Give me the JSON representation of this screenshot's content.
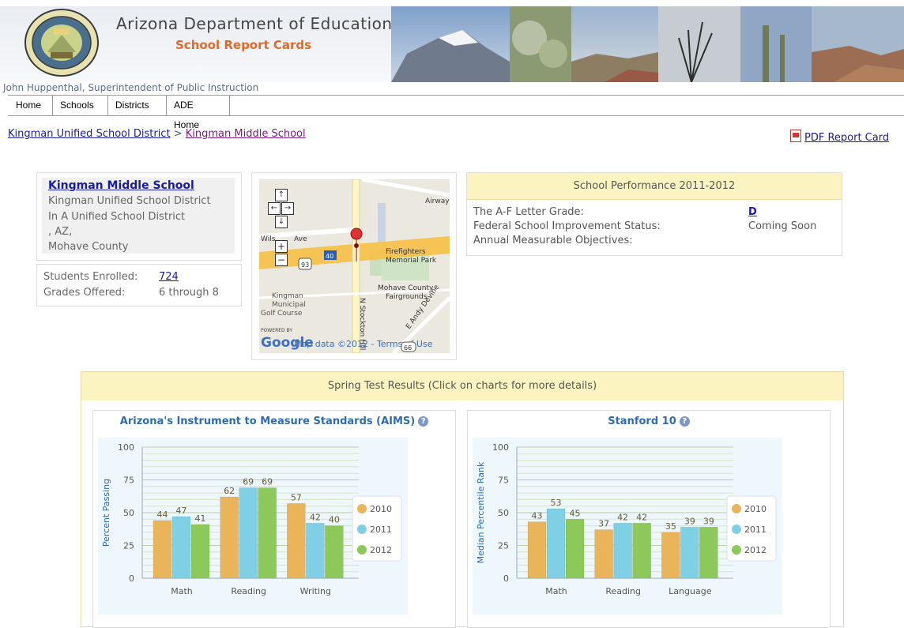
{
  "banner": {
    "title": "Arizona Department of Education",
    "subtitle": "School Report Cards",
    "superintendent": "John Huppenthal, Superintendent of Public Instruction",
    "seal_text": "GREAT SEAL OF THE STATE OF ARIZONA",
    "seal_year": "1912"
  },
  "nav": {
    "items": [
      {
        "label": "Home"
      },
      {
        "label": "Schools"
      },
      {
        "label": "Districts"
      },
      {
        "label": "ADE Home"
      }
    ]
  },
  "breadcrumb": {
    "district": "Kingman Unified School District",
    "separator": ">",
    "school": "Kingman Middle School"
  },
  "pdf_link": "PDF Report Card",
  "school": {
    "name": "Kingman Middle School",
    "district": "Kingman Unified School District",
    "district_type": "In A Unified School District",
    "city_state": ", AZ,",
    "county": "Mohave County",
    "enrolled_label": "Students Enrolled:",
    "enrolled_value": "724",
    "grades_label": "Grades Offered:",
    "grades_value": "6 through 8"
  },
  "map": {
    "labels": {
      "airway": "Airway",
      "wilson": "Wils",
      "ave": "Ave",
      "i40": "40",
      "us93": "93",
      "firefighters": "Firefighters\nMemorial Park",
      "fairgrounds": "Mohave County\nFairgrounds",
      "golf": "Kingman\nMunicipal\nGolf Course",
      "stockton": "N Stockton Hill Rd",
      "andy": "E Andy Devine",
      "powered": "POWERED BY",
      "google": "Google",
      "attrib": "Map data ©2012 - Terms of Use",
      "r66": "66"
    },
    "controls": {
      "up": "↑",
      "left": "←",
      "right": "→",
      "down": "↓",
      "zoom_in": "+",
      "zoom_out": "−"
    }
  },
  "performance": {
    "header": "School Performance 2011-2012",
    "rows": [
      {
        "label": "The A-F Letter Grade:",
        "value": "D"
      },
      {
        "label": "Federal School Improvement Status:",
        "value": "Coming Soon"
      },
      {
        "label": "Annual Measurable Objectives:",
        "value": ""
      }
    ]
  },
  "tests": {
    "header": "Spring Test Results (Click on charts for more details)"
  },
  "colors": {
    "s2010": "#eab55a",
    "s2011": "#7fd0e4",
    "s2012": "#8cc95a",
    "chart_title": "#2f6bb3",
    "panel_yellow": "#fbf4c0"
  },
  "chart_data": [
    {
      "type": "bar",
      "title": "Arizona's Instrument to Measure Standards (AIMS)",
      "ylabel": "Percent Passing",
      "ylim": [
        0,
        100
      ],
      "yticks": [
        0,
        25,
        50,
        75,
        100
      ],
      "categories": [
        "Math",
        "Reading",
        "Writing"
      ],
      "series": [
        {
          "name": "2010",
          "values": [
            44,
            62,
            57
          ]
        },
        {
          "name": "2011",
          "values": [
            47,
            69,
            42
          ]
        },
        {
          "name": "2012",
          "values": [
            41,
            69,
            40
          ]
        }
      ],
      "grid": true,
      "legend": "right"
    },
    {
      "type": "bar",
      "title": "Stanford 10",
      "ylabel": "Median Percentile Rank",
      "ylim": [
        0,
        100
      ],
      "yticks": [
        0,
        25,
        50,
        75,
        100
      ],
      "categories": [
        "Math",
        "Reading",
        "Language"
      ],
      "series": [
        {
          "name": "2010",
          "values": [
            43,
            37,
            35
          ]
        },
        {
          "name": "2011",
          "values": [
            53,
            42,
            39
          ]
        },
        {
          "name": "2012",
          "values": [
            45,
            42,
            39
          ]
        }
      ],
      "grid": true,
      "legend": "right"
    }
  ]
}
